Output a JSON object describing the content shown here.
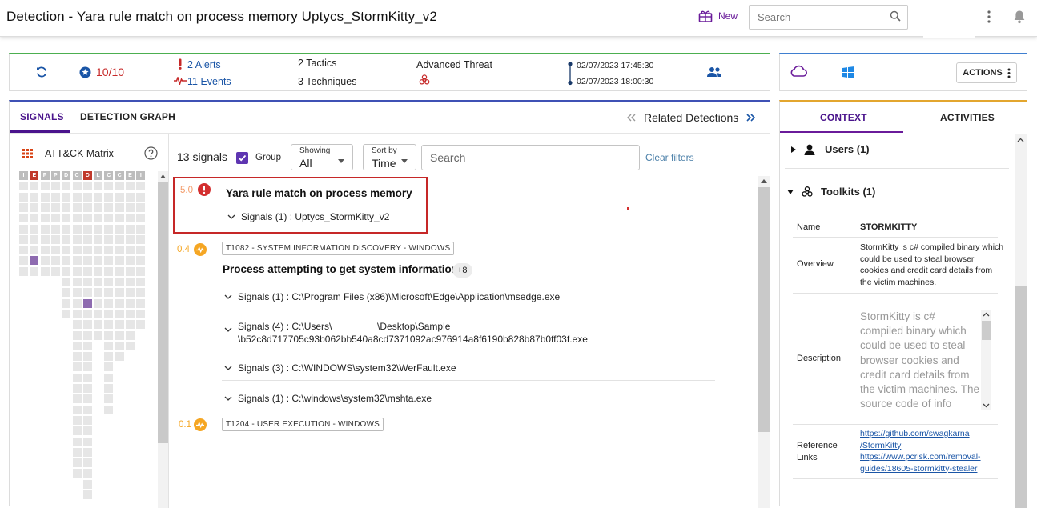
{
  "header": {
    "title": "Detection - Yara rule match on process memory Uptycs_StormKitty_v2",
    "new_label": "New",
    "search_placeholder": "Search"
  },
  "summary": {
    "score": "10/10",
    "alerts": "2 Alerts",
    "events": "11 Events",
    "tactics": "2 Tactics",
    "techniques": "3 Techniques",
    "threat_label": "Advanced Threat",
    "time_start": "02/07/2023 17:45:30",
    "time_end": "02/07/2023 18:00:30",
    "actions_label": "ACTIONS"
  },
  "tabs": {
    "signals": "SIGNALS",
    "graph": "DETECTION GRAPH",
    "related": "Related Detections"
  },
  "attck": {
    "title": "ATT&CK Matrix",
    "headers": [
      "I",
      "E",
      "P",
      "P",
      "D",
      "C",
      "D",
      "L",
      "C",
      "C",
      "E",
      "I"
    ],
    "header_active": [
      false,
      true,
      false,
      false,
      false,
      false,
      true,
      false,
      false,
      false,
      false,
      false
    ]
  },
  "signals": {
    "count": "13 signals",
    "group_label": "Group",
    "showing_label": "Showing",
    "showing_value": "All",
    "sort_label": "Sort by",
    "sort_value": "Time",
    "search_placeholder": "Search",
    "clear_filters": "Clear filters",
    "items": [
      {
        "score": "5.0",
        "title": "Yara rule match on process memory",
        "lines": [
          "Signals (1) : Uptycs_StormKitty_v2"
        ]
      },
      {
        "score": "0.4",
        "technique": "T1082 - SYSTEM INFORMATION DISCOVERY - WINDOWS",
        "title": "Process attempting to get system information",
        "extra": "+8",
        "lines": [
          "Signals (1) : C:\\Program Files (x86)\\Microsoft\\Edge\\Application\\msedge.exe",
          "Signals (4) : C:\\Users\\                 \\Desktop\\Sample",
          "\\b52c8d717705c93b062bb540a8cd7371092ac976914a8f6190b828b87b0ff03f.exe",
          "Signals (3) : C:\\WINDOWS\\system32\\WerFault.exe",
          "Signals (1) : C:\\windows\\system32\\mshta.exe"
        ]
      },
      {
        "score": "0.1",
        "technique": "T1204 - USER EXECUTION - WINDOWS"
      }
    ]
  },
  "context": {
    "tab_context": "CONTEXT",
    "tab_activities": "ACTIVITIES",
    "users_label": "Users (1)",
    "toolkits_label": "Toolkits (1)",
    "name_key": "Name",
    "name_value": "STORMKITTY",
    "overview_key": "Overview",
    "overview_value": "StormKitty is c# compiled binary which could be used to steal browser cookies and credit card details from the victim machines.",
    "description_key": "Description",
    "description_value": "StormKitty is c# compiled binary which could be used to steal browser cookies and credit card details from the victim machines. The source code of info",
    "links_key_1": "Reference",
    "links_key_2": "Links",
    "link1_a": "https://github.com/swagkarna",
    "link1_b": "/StormKitty",
    "link2_a": "https://www.pcrisk.com/removal-",
    "link2_b": "guides/18605-stormkitty-stealer"
  },
  "colors": {
    "accent_purple": "#4a148c",
    "danger_red": "#c62828",
    "score_orange": "#f5a623",
    "link_blue": "#1a55a6"
  }
}
